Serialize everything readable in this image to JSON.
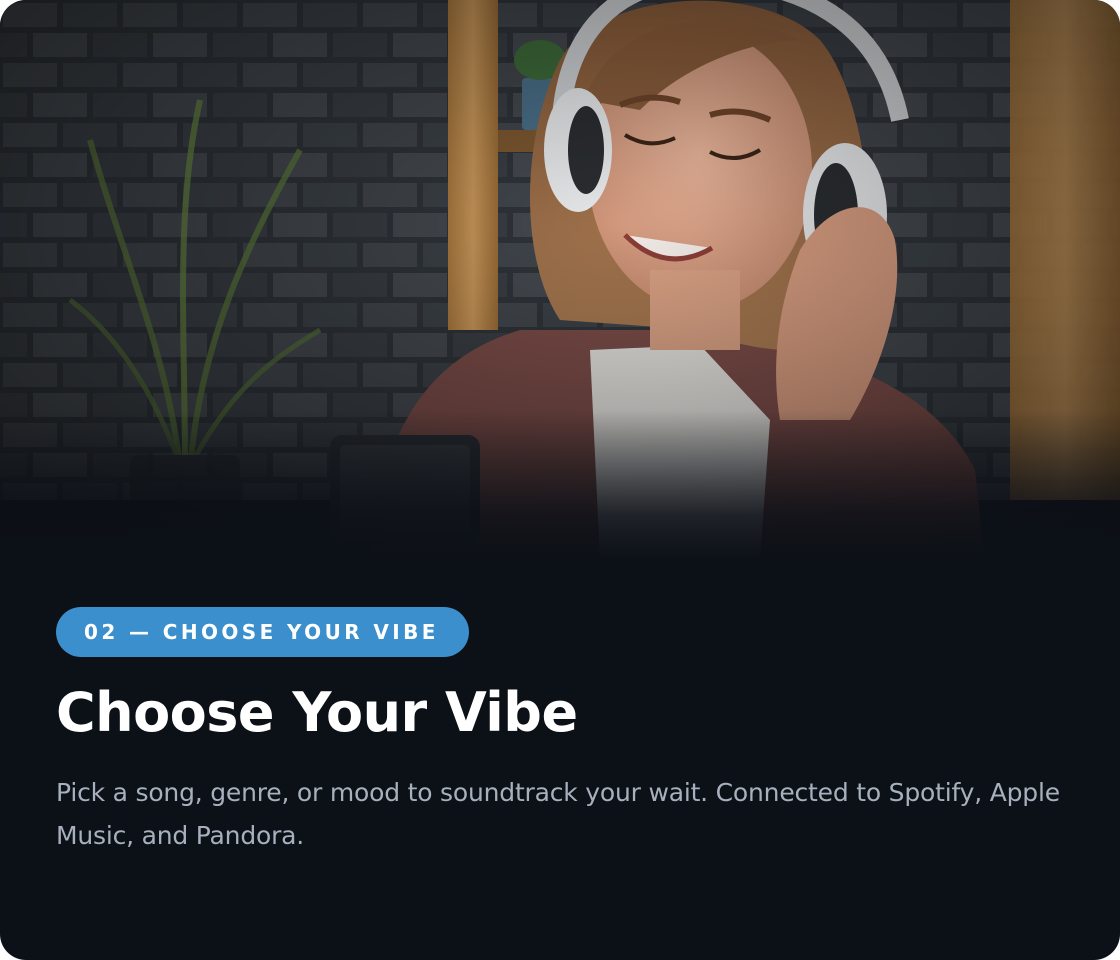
{
  "card": {
    "badge": "02 — CHOOSE YOUR VIBE",
    "title": "Choose Your Vibe",
    "description": "Pick a song, genre, or mood to soundtrack your wait. Connected to Spotify, Apple Music, and Pandora."
  },
  "hero_image": {
    "subject": "woman-with-headphones-holding-phone"
  },
  "colors": {
    "card_background": "#0c1017",
    "badge_background": "#3a8fcc",
    "title": "#ffffff",
    "description": "#a7b0bd"
  }
}
